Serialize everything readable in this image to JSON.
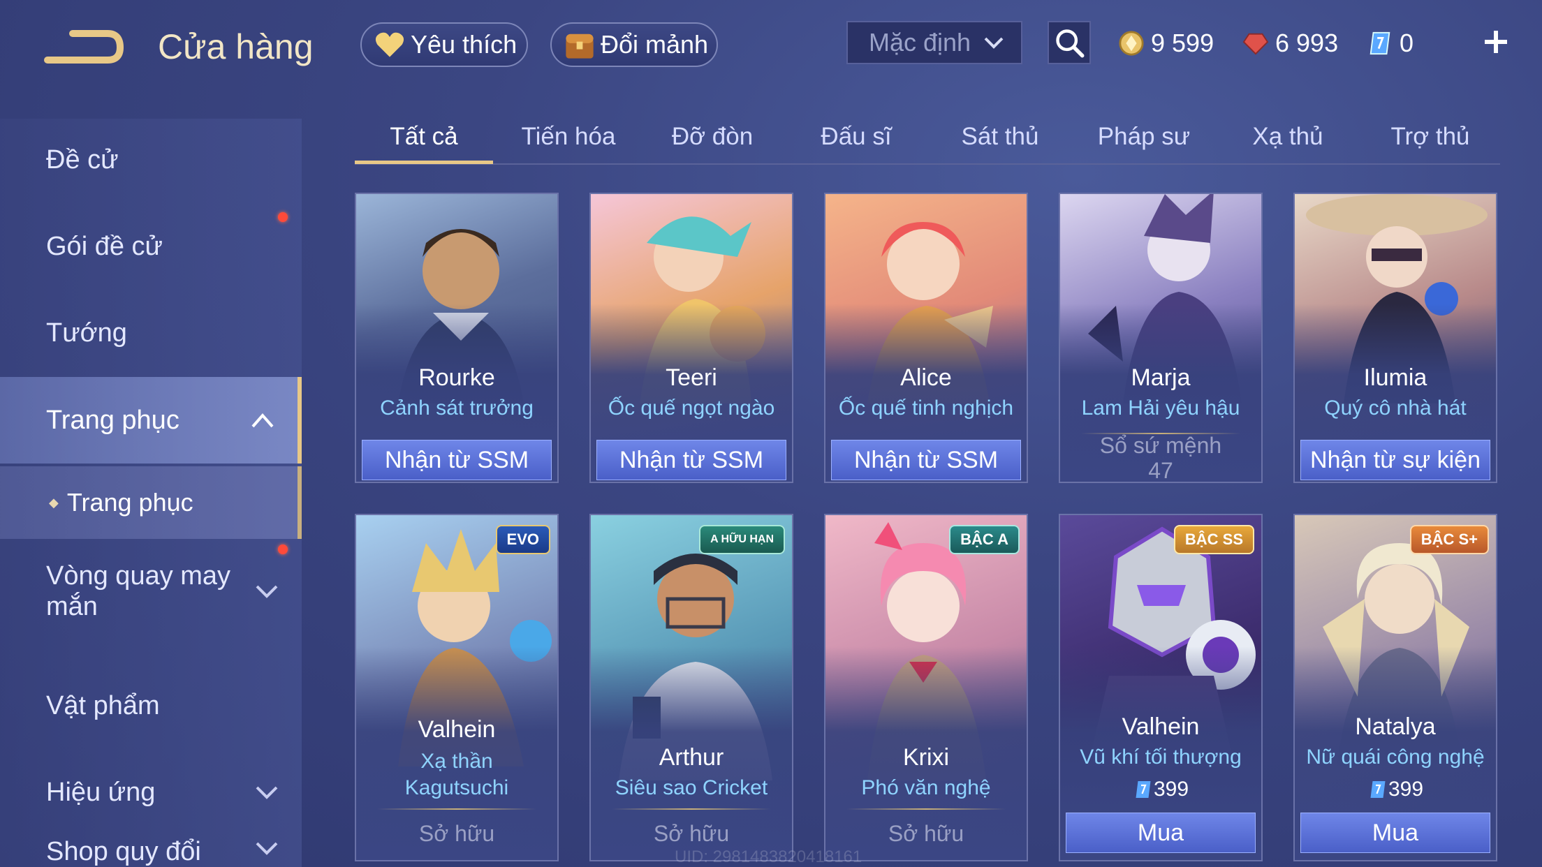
{
  "header": {
    "title": "Cửa hàng",
    "favorites_label": "Yêu thích",
    "exchange_label": "Đổi mảnh",
    "sort_label": "Mặc định",
    "currency": [
      {
        "icon": "gold-coin-icon",
        "value": "9 599",
        "color": "#e9c46a"
      },
      {
        "icon": "ruby-icon",
        "value": "6 993",
        "color": "#e0524a"
      },
      {
        "icon": "voucher-icon",
        "value": "0",
        "color": "#5aa8ff"
      }
    ]
  },
  "sidebar": {
    "items": [
      {
        "label": "Đề cử"
      },
      {
        "label": "Gói đề cử"
      },
      {
        "label": "Tướng"
      },
      {
        "label": "Trang phục"
      },
      {
        "label": "Trang phục"
      },
      {
        "label": "Vòng quay may mắn"
      },
      {
        "label": "Vật phẩm"
      },
      {
        "label": "Hiệu ứng"
      },
      {
        "label": "Shop quy đổi"
      }
    ]
  },
  "tabs": [
    "Tất cả",
    "Tiến hóa",
    "Đỡ đòn",
    "Đấu sĩ",
    "Sát thủ",
    "Pháp sư",
    "Xạ thủ",
    "Trợ thủ"
  ],
  "cards": [
    {
      "hero": "Rourke",
      "skin": "Cảnh sát trưởng",
      "action": "Nhận từ SSM"
    },
    {
      "hero": "Teeri",
      "skin": "Ốc quế ngọt ngào",
      "action": "Nhận từ SSM"
    },
    {
      "hero": "Alice",
      "skin": "Ốc quế tinh nghịch",
      "action": "Nhận từ SSM"
    },
    {
      "hero": "Marja",
      "skin": "Lam Hải yêu hậu",
      "status": "Sổ sứ mệnh",
      "status_num": "47"
    },
    {
      "hero": "Ilumia",
      "skin": "Quý cô nhà hát",
      "action": "Nhận từ sự kiện"
    },
    {
      "hero": "Valhein",
      "skin": "Xạ thần Kagutsuchi",
      "status": "Sở hữu",
      "badge": "EVO"
    },
    {
      "hero": "Arthur",
      "skin": "Siêu sao Cricket",
      "status": "Sở hữu",
      "badge": "A HỮU HẠN"
    },
    {
      "hero": "Krixi",
      "skin": "Phó văn nghệ",
      "status": "Sở hữu",
      "badge": "BẬC A"
    },
    {
      "hero": "Valhein",
      "skin": "Vũ khí tối thượng",
      "price": "399",
      "action": "Mua",
      "badge": "BẬC SS"
    },
    {
      "hero": "Natalya",
      "skin": "Nữ quái công nghệ",
      "price": "399",
      "action": "Mua",
      "badge": "BẬC S+"
    }
  ],
  "footer": {
    "uid": "UID: 2981483820418161"
  }
}
